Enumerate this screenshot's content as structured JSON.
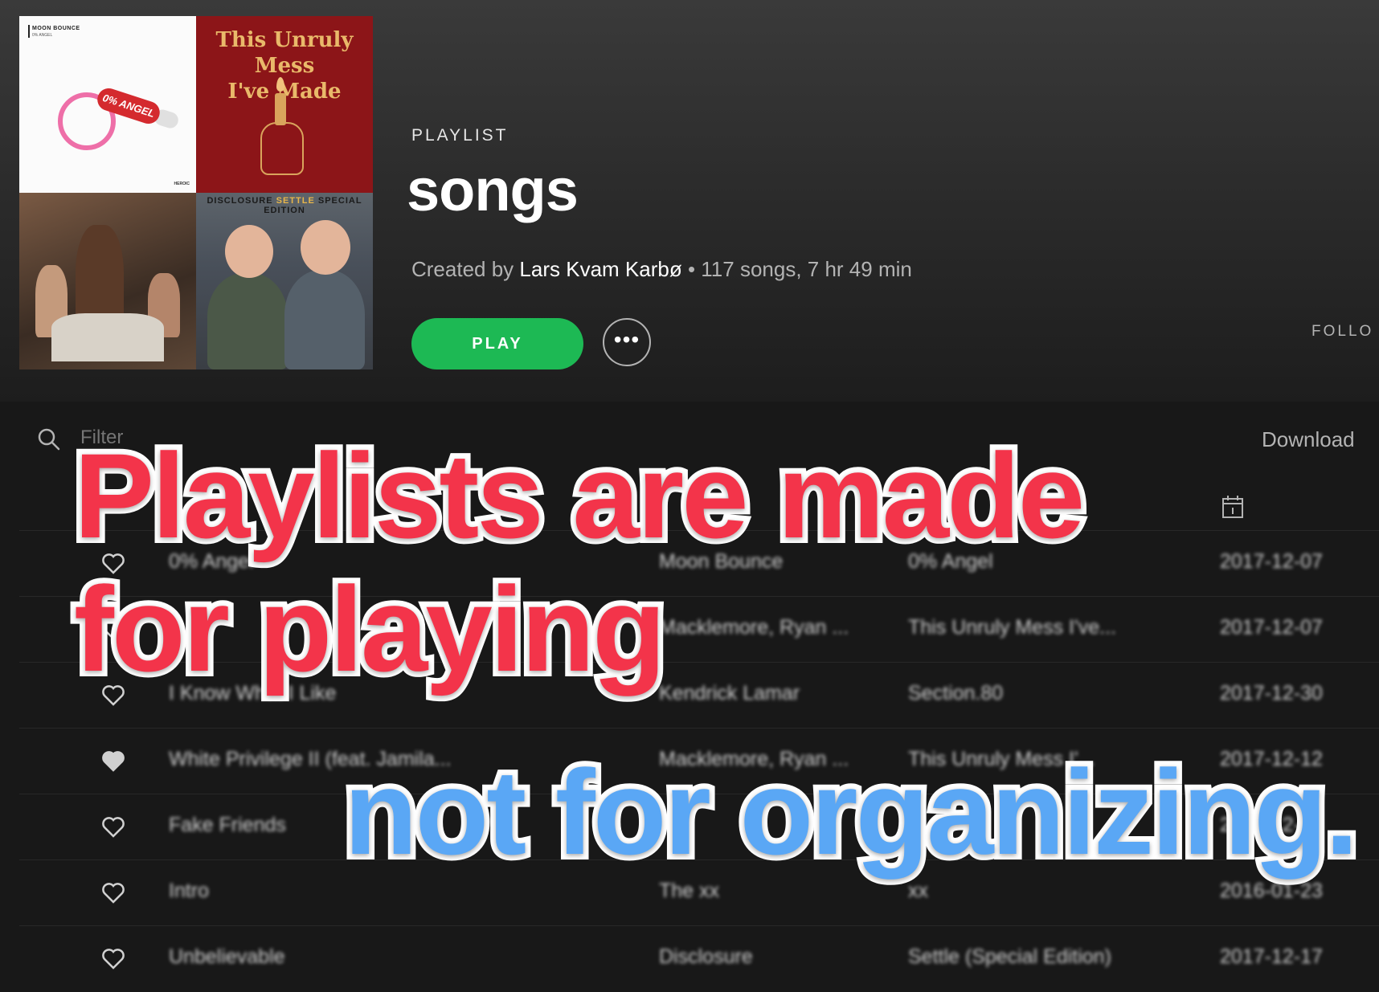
{
  "header": {
    "type_label": "PLAYLIST",
    "title": "songs",
    "created_by_prefix": "Created by",
    "owner": "Lars Kvam Karbø",
    "stats": "• 117 songs, 7 hr 49 min",
    "play_label": "PLAY",
    "more_label": "•••",
    "follow_label": "FOLLO"
  },
  "cover": {
    "tile1_title": "MOON BOUNCE",
    "tile1_sub": "0% ANGEL",
    "tile1_tag": "0% ANGEL",
    "tile1_label": "HEROIC",
    "tile2_title_line1": "This Unruly Mess",
    "tile2_title_line2": "I've Made",
    "tile4_word1": "DISCLOSURE",
    "tile4_word2": "SETTLE",
    "tile4_word3": "SPECIAL EDITION"
  },
  "toolbar": {
    "filter_placeholder": "Filter",
    "download_label": "Download"
  },
  "rows": [
    {
      "title": "0% Angel",
      "artist": "Moon Bounce",
      "album": "0% Angel",
      "date": "2017-12-07"
    },
    {
      "title": "",
      "artist": "Macklemore, Ryan ...",
      "album": "This Unruly Mess I've...",
      "date": "2017-12-07"
    },
    {
      "title": "I Know What I Like",
      "artist": "Kendrick Lamar",
      "album": "Section.80",
      "date": "2017-12-30"
    },
    {
      "title": "White Privilege II (feat. Jamila...",
      "artist": "Macklemore, Ryan ...",
      "album": "This Unruly Mess I'...",
      "date": "2017-12-12"
    },
    {
      "title": "Fake Friends",
      "artist": "",
      "album": "",
      "date": "2017-12-18"
    },
    {
      "title": "Intro",
      "artist": "The xx",
      "album": "xx",
      "date": "2016-01-23"
    },
    {
      "title": "Unbelievable",
      "artist": "Disclosure",
      "album": "Settle (Special Edition)",
      "date": "2017-12-17"
    }
  ],
  "captions": {
    "line1": "Playlists are made",
    "line2": "for playing",
    "line3": "not for organizing."
  },
  "colors": {
    "play_green": "#1db954",
    "caption_red": "#f3344a",
    "caption_blue": "#5aa7f5"
  }
}
